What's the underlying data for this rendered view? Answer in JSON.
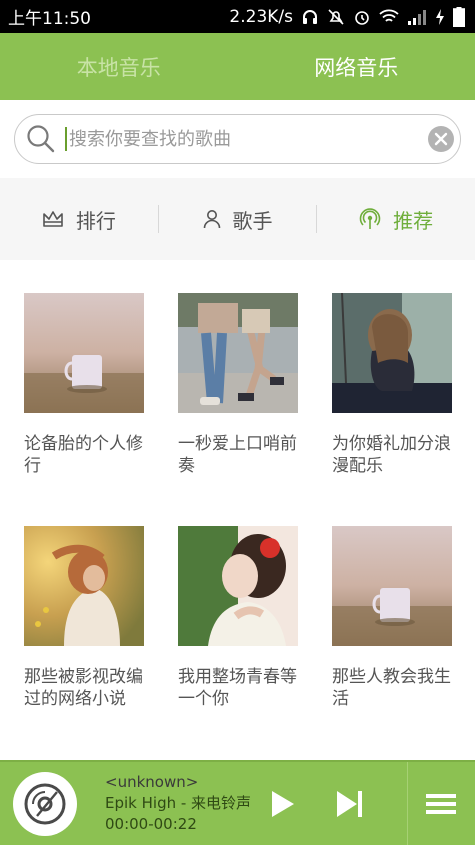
{
  "status_bar": {
    "time": "上午11:50",
    "speed": "2.23K/s"
  },
  "tabs": [
    {
      "label": "本地音乐",
      "active": false
    },
    {
      "label": "网络音乐",
      "active": true
    }
  ],
  "search": {
    "placeholder": "搜索你要查找的歌曲",
    "value": ""
  },
  "categories": [
    {
      "label": "排行",
      "icon": "crown-icon",
      "active": false
    },
    {
      "label": "歌手",
      "icon": "person-icon",
      "active": false
    },
    {
      "label": "推荐",
      "icon": "broadcast-icon",
      "active": true
    }
  ],
  "playlists": [
    {
      "title": "论备胎的个人修行",
      "image": "coffee-cup-photo"
    },
    {
      "title": "一秒爱上口哨前奏",
      "image": "couple-legs-photo"
    },
    {
      "title": "为你婚礼加分浪漫配乐",
      "image": "girl-on-swing-photo"
    },
    {
      "title": "那些被影视改编过的网络小说",
      "image": "girl-in-field-photo"
    },
    {
      "title": "我用整场青春等一个你",
      "image": "girl-with-flower-photo"
    },
    {
      "title": "那些人教会我生活",
      "image": "coffee-cup-photo"
    }
  ],
  "player": {
    "artist": "<unknown>",
    "song": "Epik High - 来电铃声",
    "time": "00:00-00:22"
  },
  "colors": {
    "brand_green": "#8cc152",
    "active_green": "#6fae3b"
  }
}
